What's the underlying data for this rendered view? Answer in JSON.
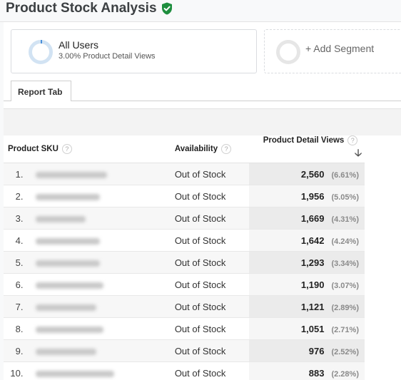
{
  "header": {
    "title": "Product Stock Analysis",
    "verified_icon": "shield-check-icon",
    "verified_color": "#1e8e3e"
  },
  "segments": [
    {
      "name": "All Users",
      "subtitle": "3.00% Product Detail Views",
      "icon": "donut-icon",
      "color": "#d2e3f3"
    },
    {
      "name": "+ Add Segment",
      "icon": "empty-circle-icon"
    }
  ],
  "tabs": [
    {
      "label": "Report Tab",
      "active": true
    }
  ],
  "table": {
    "columns": [
      {
        "label": "Product SKU",
        "help_icon": "help-icon"
      },
      {
        "label": "Availability",
        "help_icon": "help-icon"
      },
      {
        "label": "Product Detail Views",
        "help_icon": "help-icon",
        "sort": "descending",
        "sort_icon": "arrow-down-icon"
      }
    ],
    "rows": [
      {
        "index": "1.",
        "sku": "[redacted]",
        "availability": "Out of Stock",
        "views": "2,560",
        "pct": "(6.61%)"
      },
      {
        "index": "2.",
        "sku": "[redacted]",
        "availability": "Out of Stock",
        "views": "1,956",
        "pct": "(5.05%)"
      },
      {
        "index": "3.",
        "sku": "[redacted]",
        "availability": "Out of Stock",
        "views": "1,669",
        "pct": "(4.31%)"
      },
      {
        "index": "4.",
        "sku": "[redacted]",
        "availability": "Out of Stock",
        "views": "1,642",
        "pct": "(4.24%)"
      },
      {
        "index": "5.",
        "sku": "[redacted]",
        "availability": "Out of Stock",
        "views": "1,293",
        "pct": "(3.34%)"
      },
      {
        "index": "6.",
        "sku": "[redacted]",
        "availability": "Out of Stock",
        "views": "1,190",
        "pct": "(3.07%)"
      },
      {
        "index": "7.",
        "sku": "[redacted]",
        "availability": "Out of Stock",
        "views": "1,121",
        "pct": "(2.89%)"
      },
      {
        "index": "8.",
        "sku": "[redacted]",
        "availability": "Out of Stock",
        "views": "1,051",
        "pct": "(2.71%)"
      },
      {
        "index": "9.",
        "sku": "[redacted]",
        "availability": "Out of Stock",
        "views": "976",
        "pct": "(2.52%)"
      },
      {
        "index": "10.",
        "sku": "[redacted]",
        "availability": "Out of Stock",
        "views": "883",
        "pct": "(2.28%)"
      }
    ]
  }
}
